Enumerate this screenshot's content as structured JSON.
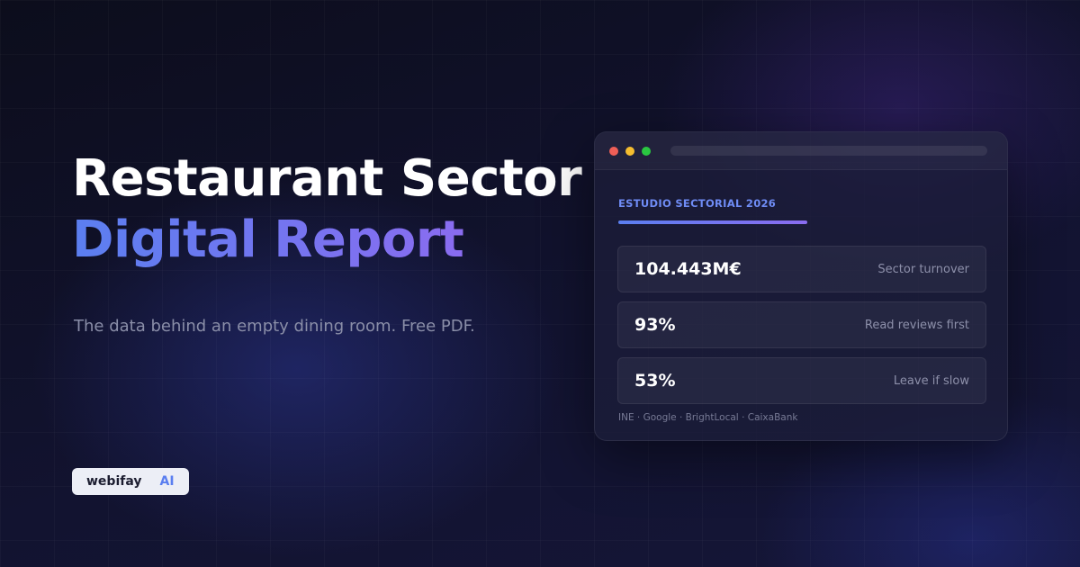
{
  "hero": {
    "title_line1": "Restaurant Sector",
    "title_line2": "Digital Report",
    "subtitle": "The data behind an empty dining room. Free PDF."
  },
  "brand": {
    "name": "webifay",
    "suffix": "AI"
  },
  "report_card": {
    "eyebrow": "ESTUDIO SECTORIAL 2026",
    "stats": [
      {
        "value": "104.443M€",
        "label": "Sector turnover"
      },
      {
        "value": "93%",
        "label": "Read reviews first"
      },
      {
        "value": "53%",
        "label": "Leave if slow"
      }
    ],
    "sources": "INE · Google · BrightLocal · CaixaBank"
  },
  "colors": {
    "accent_blue": "#5b7ff0",
    "accent_purple": "#8a6cf0",
    "background": "#0e0f22",
    "window_dot_red": "#ef5f57",
    "window_dot_yellow": "#f5bd2f",
    "window_dot_green": "#2ac741"
  }
}
